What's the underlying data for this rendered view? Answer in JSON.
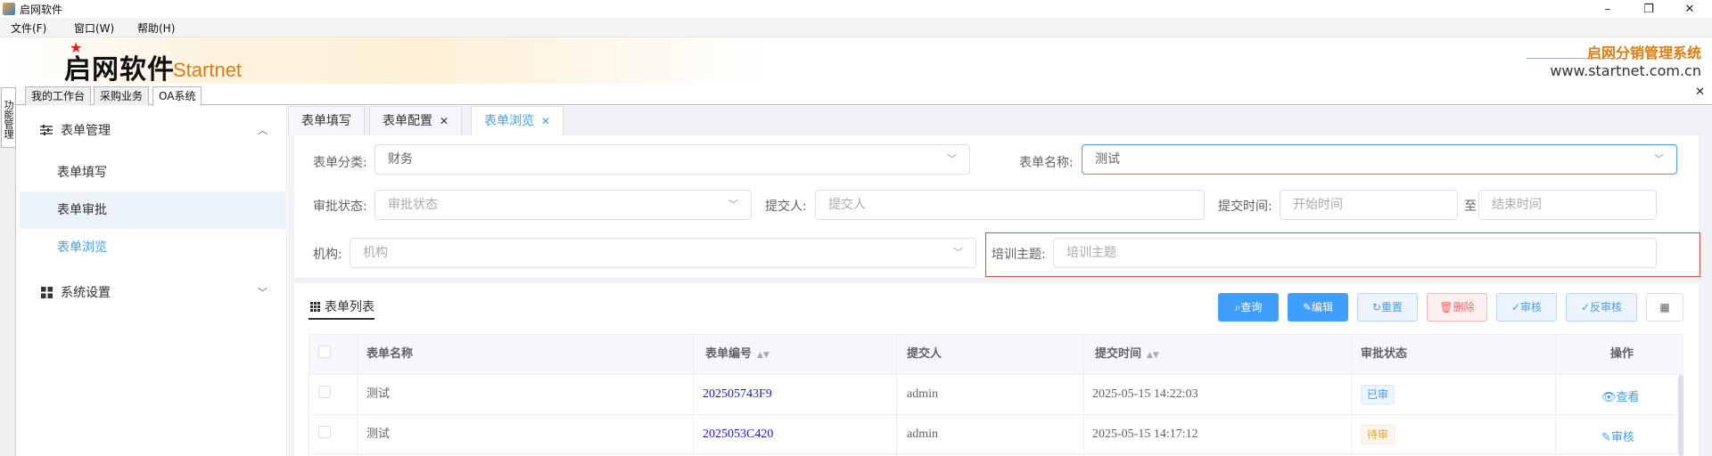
{
  "window": {
    "title": "启网软件",
    "minimize": "–",
    "maximize": "❐",
    "close": "✕"
  },
  "menu": [
    "文件(F)",
    "窗口(W)",
    "帮助(H)"
  ],
  "banner": {
    "brand_cn": "启网软件",
    "brand_en": "Startnet",
    "system_name": "启网分销管理系统",
    "url": "www.startnet.com.cn"
  },
  "top_tabs": [
    "我的工作台",
    "采购业务",
    "OA系统"
  ],
  "vertical_tab": "功能管理",
  "sidebar": {
    "groups": [
      {
        "label": "表单管理",
        "icon": "sliders-icon",
        "expanded": true,
        "items": [
          "表单填写",
          "表单审批",
          "表单浏览"
        ]
      },
      {
        "label": "系统设置",
        "icon": "grid-icon",
        "expanded": false,
        "items": []
      }
    ],
    "active_item": "表单浏览",
    "highlighted_item": "表单审批"
  },
  "page_tabs": [
    {
      "label": "表单填写",
      "closable": false
    },
    {
      "label": "表单配置",
      "closable": true
    },
    {
      "label": "表单浏览",
      "closable": true,
      "active": true
    }
  ],
  "form": {
    "category": {
      "label": "表单分类:",
      "value": "财务"
    },
    "form_name": {
      "label": "表单名称:",
      "value": "测试"
    },
    "status": {
      "label": "审批状态:",
      "placeholder": "审批状态"
    },
    "submitter": {
      "label": "提交人:",
      "placeholder": "提交人"
    },
    "submit_time": {
      "label": "提交时间:",
      "start_placeholder": "开始时间",
      "separator": "至",
      "end_placeholder": "结束时间"
    },
    "org": {
      "label": "机构:",
      "placeholder": "机构"
    },
    "topic": {
      "label": "培训主题:",
      "placeholder": "培训主题"
    }
  },
  "list": {
    "title": "表单列表",
    "buttons": {
      "query": "查询",
      "edit": "编辑",
      "reset": "重置",
      "delete": "删除",
      "approve": "审核",
      "unapprove": "反审核"
    },
    "columns": [
      "表单名称",
      "表单编号",
      "提交人",
      "提交时间",
      "审批状态",
      "操作"
    ],
    "rows": [
      {
        "name": "测试",
        "code": "202505743F9",
        "submitter": "admin",
        "time": "2025-05-15 14:22:03",
        "status": "已审",
        "op": "查看"
      },
      {
        "name": "测试",
        "code": "2025053C420",
        "submitter": "admin",
        "time": "2025-05-15 14:17:12",
        "status": "待审",
        "op": "审核"
      }
    ]
  },
  "colors": {
    "accent": "#409eff",
    "brand_orange": "#e07b12",
    "danger": "#f56c6c",
    "warning": "#e6a23c"
  }
}
